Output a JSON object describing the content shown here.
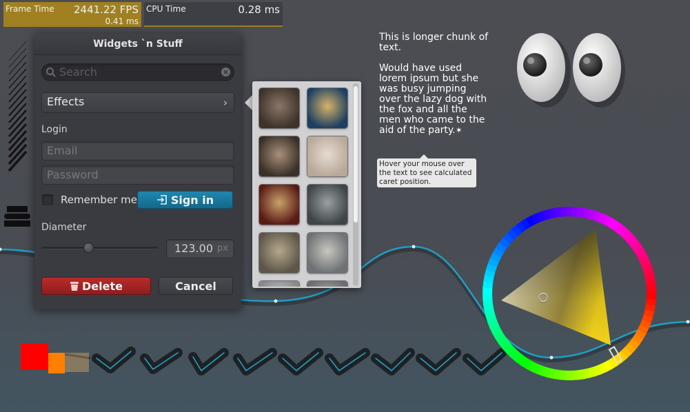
{
  "perf": {
    "frame": {
      "label": "Frame Time",
      "value": "2441.22 FPS",
      "sub": "0.41 ms"
    },
    "cpu": {
      "label": "CPU Time",
      "value": "0.28 ms"
    }
  },
  "window": {
    "title": "Widgets `n Stuff",
    "search_placeholder": "Search",
    "effects_label": "Effects",
    "login_label": "Login",
    "email_placeholder": "Email",
    "password_placeholder": "Password",
    "remember_label": "Remember me",
    "signin_label": "Sign in",
    "diameter_label": "Diameter",
    "diameter_value": "123.00",
    "diameter_unit": "px",
    "slider_fraction": 0.4,
    "delete_label": "Delete",
    "cancel_label": "Cancel"
  },
  "paragraph": {
    "p1": "This is longer chunk of text.",
    "p2": "Would have used lorem ipsum but she was busy jumping over the lazy dog with the fox and all the men who came to the aid of the party.",
    "tooltip": "Hover your mouse over the text to see calculated caret position."
  },
  "thumbnails": [
    {
      "name": "dog-nose-thumbnail",
      "colors": [
        "#3e3229",
        "#8a7668"
      ]
    },
    {
      "name": "jellyfish-thumbnail",
      "colors": [
        "#1d3f61",
        "#d6b36a"
      ]
    },
    {
      "name": "squirrel-thumbnail",
      "colors": [
        "#3a3028",
        "#a89078"
      ]
    },
    {
      "name": "bunny-thumbnail",
      "colors": [
        "#b8a89a",
        "#e6dbd0"
      ]
    },
    {
      "name": "pirate-cat-thumbnail",
      "colors": [
        "#5a1b16",
        "#c8a26a"
      ]
    },
    {
      "name": "kitten-thumbnail",
      "colors": [
        "#3f4446",
        "#9aa1a3"
      ]
    },
    {
      "name": "tortoise-thumbnail",
      "colors": [
        "#5d5648",
        "#b5a88d"
      ]
    },
    {
      "name": "mouse-thumbnail",
      "colors": [
        "#6d7274",
        "#c8c6c0"
      ]
    },
    {
      "name": "partial-thumbnail-1",
      "colors": [
        "#8a8a8a",
        "#cfcfcf"
      ]
    },
    {
      "name": "partial-thumbnail-2",
      "colors": [
        "#6e6e6e",
        "#b0b0b0"
      ]
    }
  ],
  "colors": {
    "frame_graph": "#a08020",
    "accent_blue": "#1c7ca4",
    "delete_red": "#a42424",
    "curve": "#1e9fc4",
    "picker_selected": "#e6e6c8"
  }
}
